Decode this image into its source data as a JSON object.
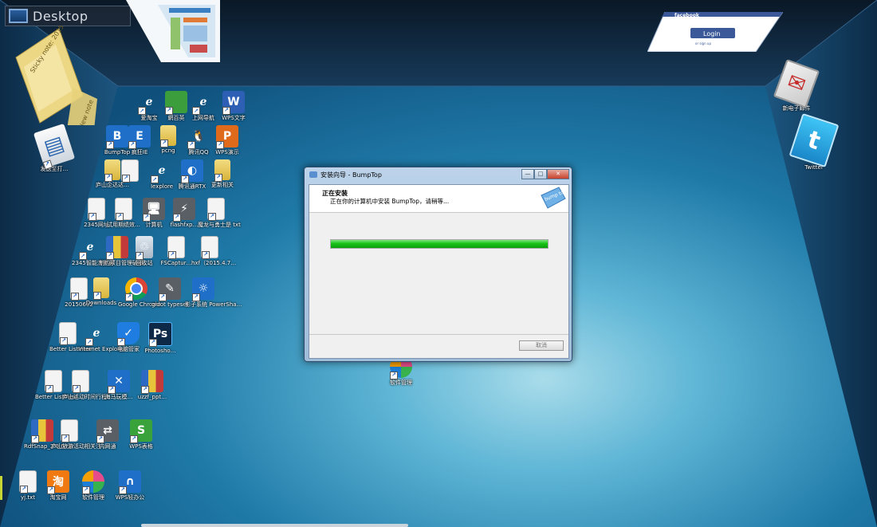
{
  "desktop": {
    "label": "Desktop"
  },
  "widgets": {
    "sticky_note": "Sticky note: 2015 new notes",
    "new_note": "New note",
    "facebook_brand": "facebook",
    "facebook_login": "Login",
    "facebook_signup": "or sign up"
  },
  "icons": [
    {
      "id": "aitaobao",
      "label": "爱淘宝",
      "style": "ie"
    },
    {
      "id": "wangbaiying",
      "label": "網百英",
      "style": "green"
    },
    {
      "id": "shangwang",
      "label": "上网导航",
      "style": "ie"
    },
    {
      "id": "wps-word",
      "label": "WPS文字",
      "style": "wps-w",
      "glyph": "W"
    },
    {
      "id": "bumptop",
      "label": "BumpTop",
      "style": "blue",
      "glyph": "B"
    },
    {
      "id": "crazy-ie",
      "label": "疯狂IE",
      "style": "blue",
      "glyph": "E"
    },
    {
      "id": "pcng",
      "label": "pcng",
      "style": "folder"
    },
    {
      "id": "tencent-qq",
      "label": "腾讯QQ",
      "style": "qq",
      "glyph": "🐧"
    },
    {
      "id": "wps-ppt",
      "label": "WPS演示",
      "style": "wps-p",
      "glyph": "P"
    },
    {
      "id": "send-to",
      "label": "发送至打…",
      "style": "gray",
      "glyph": "▤"
    },
    {
      "id": "lushan-1",
      "label": "庐山企达达…",
      "style": "folder"
    },
    {
      "id": "lushan-2",
      "label": "",
      "style": "doc"
    },
    {
      "id": "iexplore",
      "label": "Iexplore",
      "style": "ie"
    },
    {
      "id": "tencent-rtx",
      "label": "腾讯通RTX",
      "style": "blue",
      "glyph": "◐"
    },
    {
      "id": "update",
      "label": "更新相关",
      "style": "folder"
    },
    {
      "id": "site-2345",
      "label": "2345网址",
      "style": "doc"
    },
    {
      "id": "trial",
      "label": "试用期绩效…",
      "style": "doc"
    },
    {
      "id": "computer",
      "label": "计算机",
      "style": "gray",
      "glyph": "🖥"
    },
    {
      "id": "flashfxp",
      "label": "flashfxp…",
      "style": "gray",
      "glyph": "⚡"
    },
    {
      "id": "mojian",
      "label": "魔龙与勇士是 txt",
      "style": "doc"
    },
    {
      "id": "browser-2345",
      "label": "2345智能浏览器",
      "style": "ie"
    },
    {
      "id": "zip-1",
      "label": "制约项目管理破解…",
      "style": "zip"
    },
    {
      "id": "recycle",
      "label": "回收站",
      "style": "recycle",
      "glyph": "♲"
    },
    {
      "id": "fscapture",
      "label": "FSCaptur…",
      "style": "doc"
    },
    {
      "id": "hxf",
      "label": "hxf（2015.4.7…",
      "style": "doc"
    },
    {
      "id": "downloads-txt",
      "label": "20150602",
      "style": "doc"
    },
    {
      "id": "downloads",
      "label": "Downloads",
      "style": "folder"
    },
    {
      "id": "chrome",
      "label": "Google Chrome",
      "style": "chrome"
    },
    {
      "id": "gidot",
      "label": "gidot typeset…",
      "style": "gray",
      "glyph": "✎"
    },
    {
      "id": "yingzi",
      "label": "影子系统 PowerSha…",
      "style": "blue",
      "glyph": "☼"
    },
    {
      "id": "better-listview",
      "label": "Better ListView",
      "style": "doc"
    },
    {
      "id": "internet-explorer",
      "label": "Internet Explorer",
      "style": "ie"
    },
    {
      "id": "pc-manager",
      "label": "电脑管家",
      "style": "shield",
      "glyph": "✓"
    },
    {
      "id": "photoshop",
      "label": "Photosho…",
      "style": "ps",
      "glyph": "Ps"
    },
    {
      "id": "better-listview-2",
      "label": "Better ListView",
      "style": "doc"
    },
    {
      "id": "lushan-schedule",
      "label": "庐山活动时间行程…",
      "style": "doc"
    },
    {
      "id": "haima",
      "label": "海马玩模…",
      "style": "blue",
      "glyph": "✕"
    },
    {
      "id": "uzzf",
      "label": "uzzf_ppt…",
      "style": "zip"
    },
    {
      "id": "rdfsnap",
      "label": "RdfSnap_2.0.6.rar",
      "style": "zip"
    },
    {
      "id": "lushan-note",
      "label": "庐山旅游活动相关注…",
      "style": "doc"
    },
    {
      "id": "intranet",
      "label": "内网通",
      "style": "gray",
      "glyph": "⇄"
    },
    {
      "id": "wps-sheet",
      "label": "WPS表格",
      "style": "wps-s",
      "glyph": "S"
    },
    {
      "id": "yj-txt",
      "label": "yj.txt",
      "style": "doc"
    },
    {
      "id": "taobao",
      "label": "淘宝网",
      "style": "taobao",
      "glyph": "淘"
    },
    {
      "id": "software-mgr",
      "label": "软件管理",
      "style": "pinwheel"
    },
    {
      "id": "wps-office",
      "label": "WPS轻办公",
      "style": "blue",
      "glyph": "∩"
    },
    {
      "id": "software-center",
      "label": "软件管理",
      "style": "pinwheel"
    },
    {
      "id": "new-mail",
      "label": "新电子邮件",
      "style": "mail"
    },
    {
      "id": "twitter",
      "label": "Twitter",
      "style": "twitter"
    }
  ],
  "dialog": {
    "title": "安装向导 - BumpTop",
    "heading": "正在安装",
    "subheading": "正在你的计算机中安装 BumpTop，请稍等...",
    "progress": 1.0,
    "cancel_label": "取消",
    "minimize": "—",
    "maximize": "□",
    "close": "✕",
    "logo_text": "bump top"
  },
  "colors": {
    "progress": "#17c217",
    "room": "#1b6fa0"
  }
}
